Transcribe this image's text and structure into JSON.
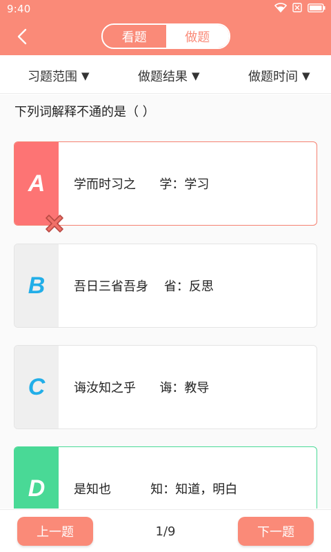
{
  "status_bar": {
    "time": "9:40"
  },
  "nav": {
    "tabs": [
      {
        "label": "看题",
        "active": false
      },
      {
        "label": "做题",
        "active": true
      }
    ]
  },
  "filters": [
    {
      "label": "习题范围",
      "caret": "▼"
    },
    {
      "label": "做题结果",
      "caret": "▼"
    },
    {
      "label": "做题时间",
      "caret": "▼"
    }
  ],
  "question": {
    "text": "下列词解释不通的是（   ）"
  },
  "options": [
    {
      "letter": "A",
      "text": "学而时习之      学：学习",
      "state": "wrong"
    },
    {
      "letter": "B",
      "text": "吾日三省吾身    省：反思",
      "state": "normal"
    },
    {
      "letter": "C",
      "text": "诲汝知之乎      诲：教导",
      "state": "normal"
    },
    {
      "letter": "D",
      "text": "是知也          知：知道，明白",
      "state": "correct"
    }
  ],
  "footer": {
    "prev_label": "上一题",
    "page": "1/9",
    "next_label": "下一题"
  },
  "colors": {
    "primary": "#FA8A78",
    "wrong": "#FD7474",
    "correct": "#49D996",
    "letter_blue": "#22AEE8"
  }
}
